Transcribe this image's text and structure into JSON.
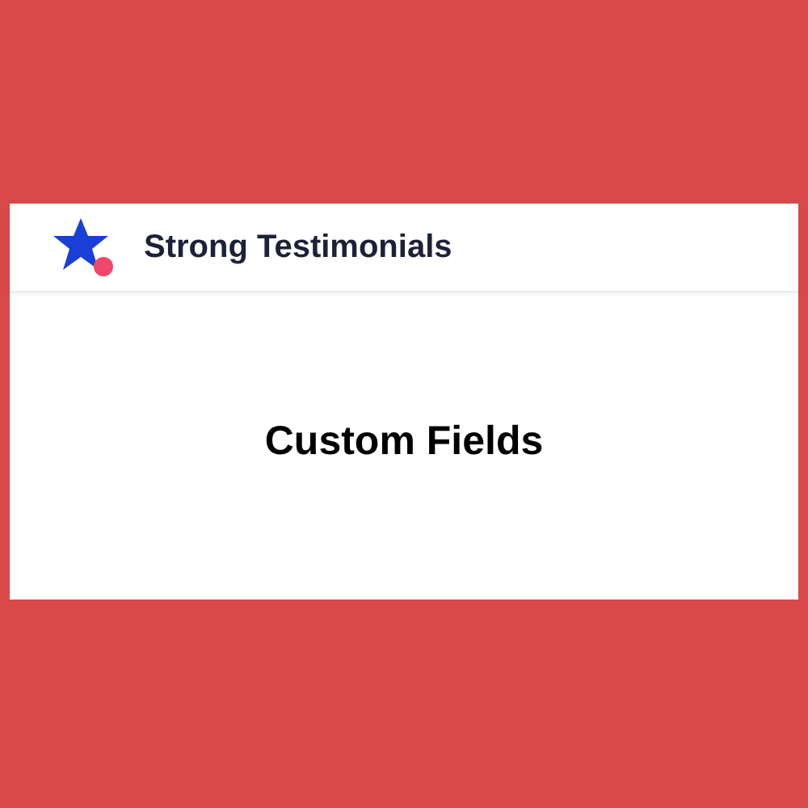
{
  "header": {
    "title": "Strong Testimonials"
  },
  "content": {
    "heading": "Custom Fields"
  }
}
